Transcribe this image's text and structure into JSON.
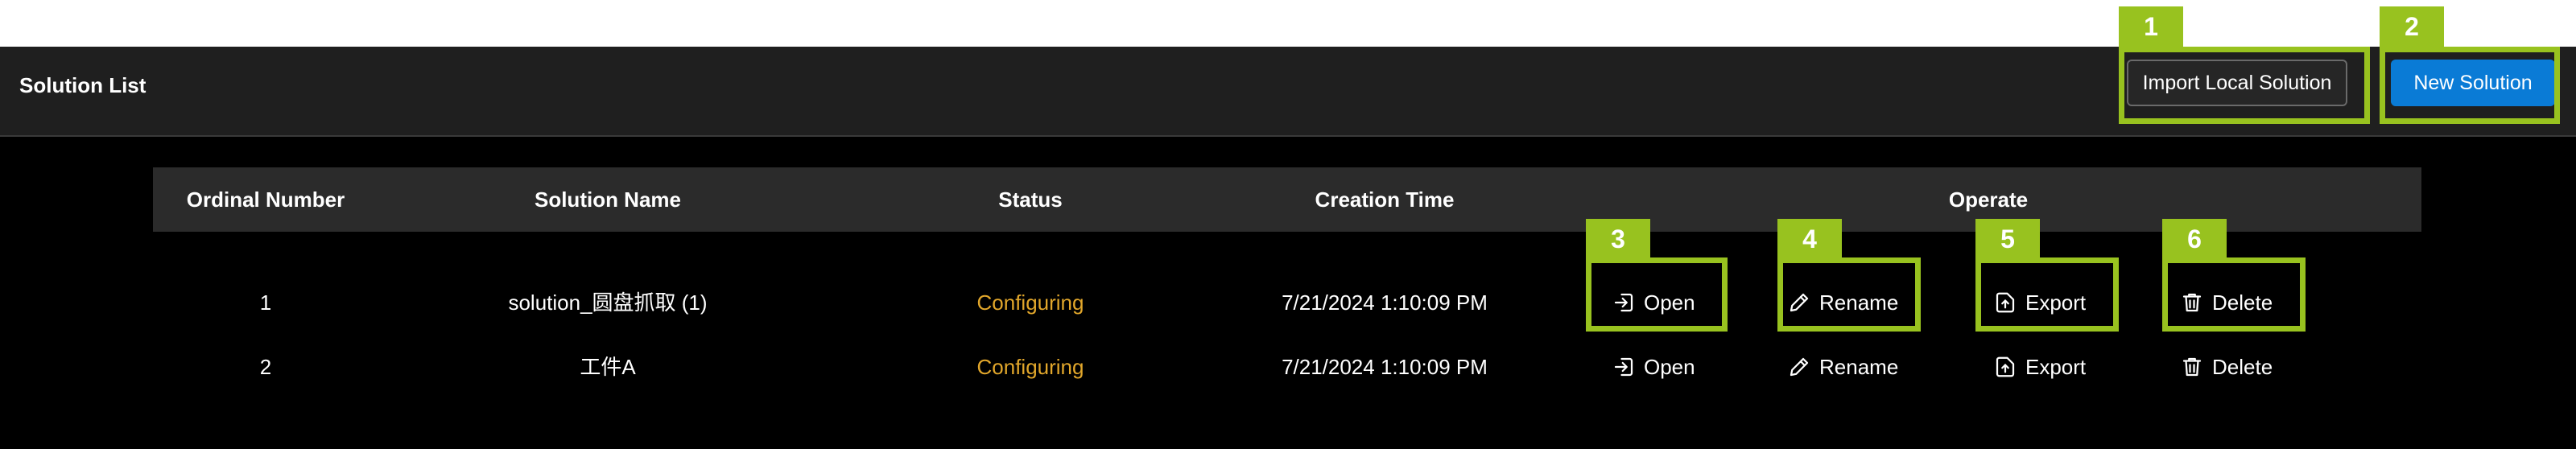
{
  "header": {
    "title": "Solution List",
    "import_label": "Import Local Solution",
    "new_label": "New Solution"
  },
  "table": {
    "columns": [
      "Ordinal Number",
      "Solution Name",
      "Status",
      "Creation Time",
      "Operate"
    ],
    "rows": [
      {
        "ordinal": "1",
        "name": "solution_圆盘抓取 (1)",
        "status": "Configuring",
        "created": "7/21/2024 1:10:09 PM",
        "ops": [
          "Open",
          "Rename",
          "Export",
          "Delete"
        ]
      },
      {
        "ordinal": "2",
        "name": "工件A",
        "status": "Configuring",
        "created": "7/21/2024 1:10:09 PM",
        "ops": [
          "Open",
          "Rename",
          "Export",
          "Delete"
        ]
      }
    ]
  },
  "callouts": [
    "1",
    "2",
    "3",
    "4",
    "5",
    "6"
  ],
  "colors": {
    "accent": "#0a7bd6",
    "status": "#e2a72b",
    "callout": "#98c21f"
  },
  "icons": [
    "open-icon",
    "rename-pencil-icon",
    "export-icon",
    "delete-trash-icon"
  ]
}
